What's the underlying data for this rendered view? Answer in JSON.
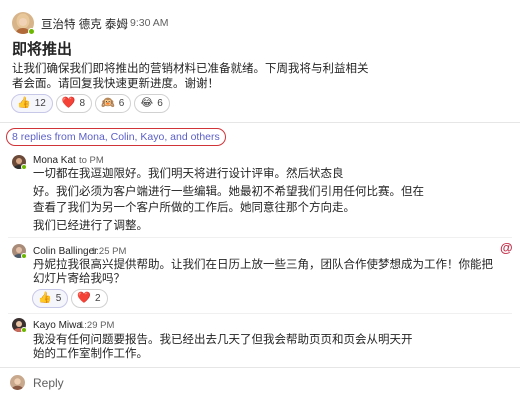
{
  "post": {
    "author": "亘治特 德克 泰姆",
    "time": "9:30 AM",
    "title": "即将推出",
    "body_lines": [
      "让我们确保我们即将推出的营销材料已准备就绪。下周我将与利益相关",
      "者会面。请回复我快速更新进度。谢谢！"
    ],
    "reactions": [
      {
        "emoji": "👍",
        "count": "12",
        "color": "#f5b400"
      },
      {
        "emoji": "❤️",
        "count": "8",
        "color": "#d13438"
      },
      {
        "emoji": "🙉",
        "count": "6",
        "color": "#c4864c"
      },
      {
        "emoji": "😂",
        "count": "6",
        "color": "#f5b400"
      }
    ]
  },
  "thread": {
    "replies_summary": "8 replies from Mona, Colin, Kayo, and others"
  },
  "replies": [
    {
      "author": "Mona Kat",
      "time": "to PM",
      "body_lines": [
        "一切都在我逗迦限好。我们明天将进行设计评审。然后状态良",
        "好。我们必须为客户端进行一些编辑。她最初不希望我们引用任何比赛。但在",
        "查看了我们为另一个客户所做的工作后。她同意往那个方向走。",
        "我们已经进行了调整。"
      ]
    },
    {
      "author": "Colin Ballinger",
      "time": "1:25 PM",
      "mention_symbol": "@",
      "body_lines": [
        "丹妮拉我很高兴提供帮助。让我们在日历上放一些三角，团队合作使梦想成为工作！你能把",
        "幻灯片寄给我吗？"
      ],
      "reactions": [
        {
          "emoji": "👍",
          "count": "5",
          "color": "#f5b400"
        },
        {
          "emoji": "❤️",
          "count": "2",
          "color": "#d13438"
        }
      ]
    },
    {
      "author": "Kayo Miwa",
      "time": "1:29 PM",
      "body_lines": [
        "我没有任何问题要报告。我已经出去几天了但我会帮助页页和页会从明天开",
        "始的工作室制作工作。"
      ]
    }
  ],
  "composer": {
    "reply_placeholder": "Reply"
  }
}
